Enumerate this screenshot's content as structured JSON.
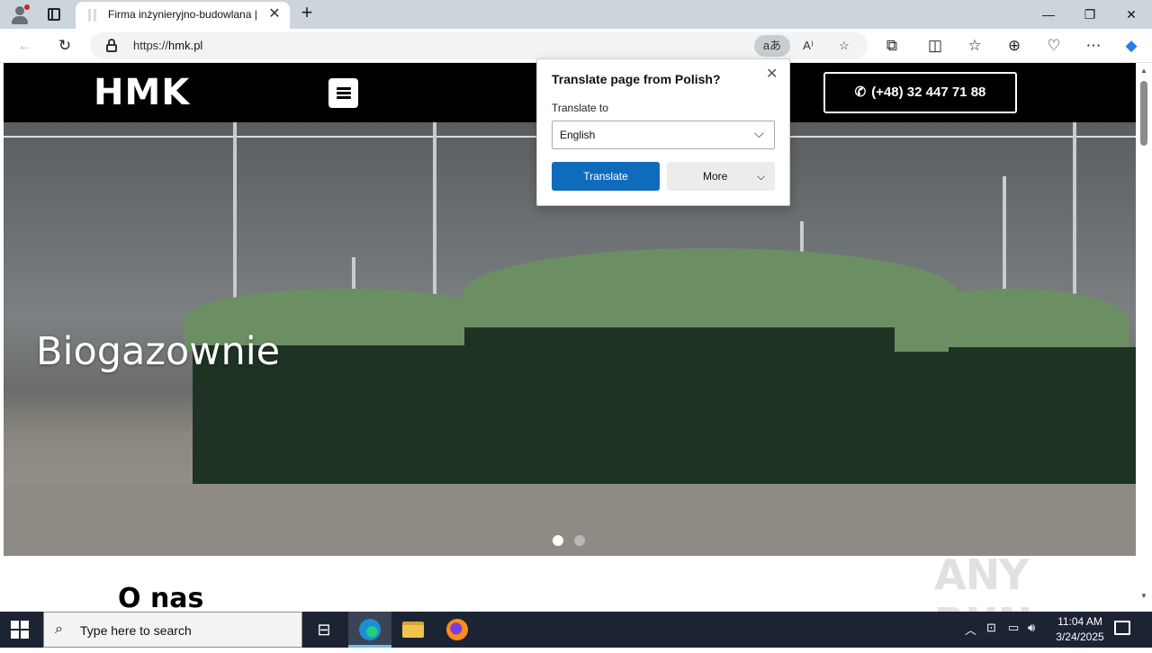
{
  "browser": {
    "tab_title": "Firma inżynieryjno-budowlana | H",
    "tab_close_glyph": "✕",
    "new_tab_glyph": "+",
    "url_scheme": "https://",
    "url_host": "hmk.pl",
    "window_controls": {
      "minimize": "—",
      "maximize": "❐",
      "close": "✕"
    }
  },
  "site": {
    "logo": "HMK",
    "phone": "(+48) 32 447 71 88",
    "hero_title": "Biogazownie",
    "slides": {
      "count": 2,
      "active": 1
    },
    "about_heading": "O nas"
  },
  "translate_popup": {
    "title": "Translate page from Polish?",
    "translate_to_label": "Translate to",
    "selected_language": "English",
    "translate_button": "Translate",
    "more_button": "More"
  },
  "watermark": "ANY RUN",
  "taskbar": {
    "search_placeholder": "Type here to search",
    "time": "11:04 AM",
    "date": "3/24/2025"
  },
  "colors": {
    "accent_blue": "#0f6cbd",
    "header_black": "#000000",
    "taskbar": "#1c2434"
  }
}
